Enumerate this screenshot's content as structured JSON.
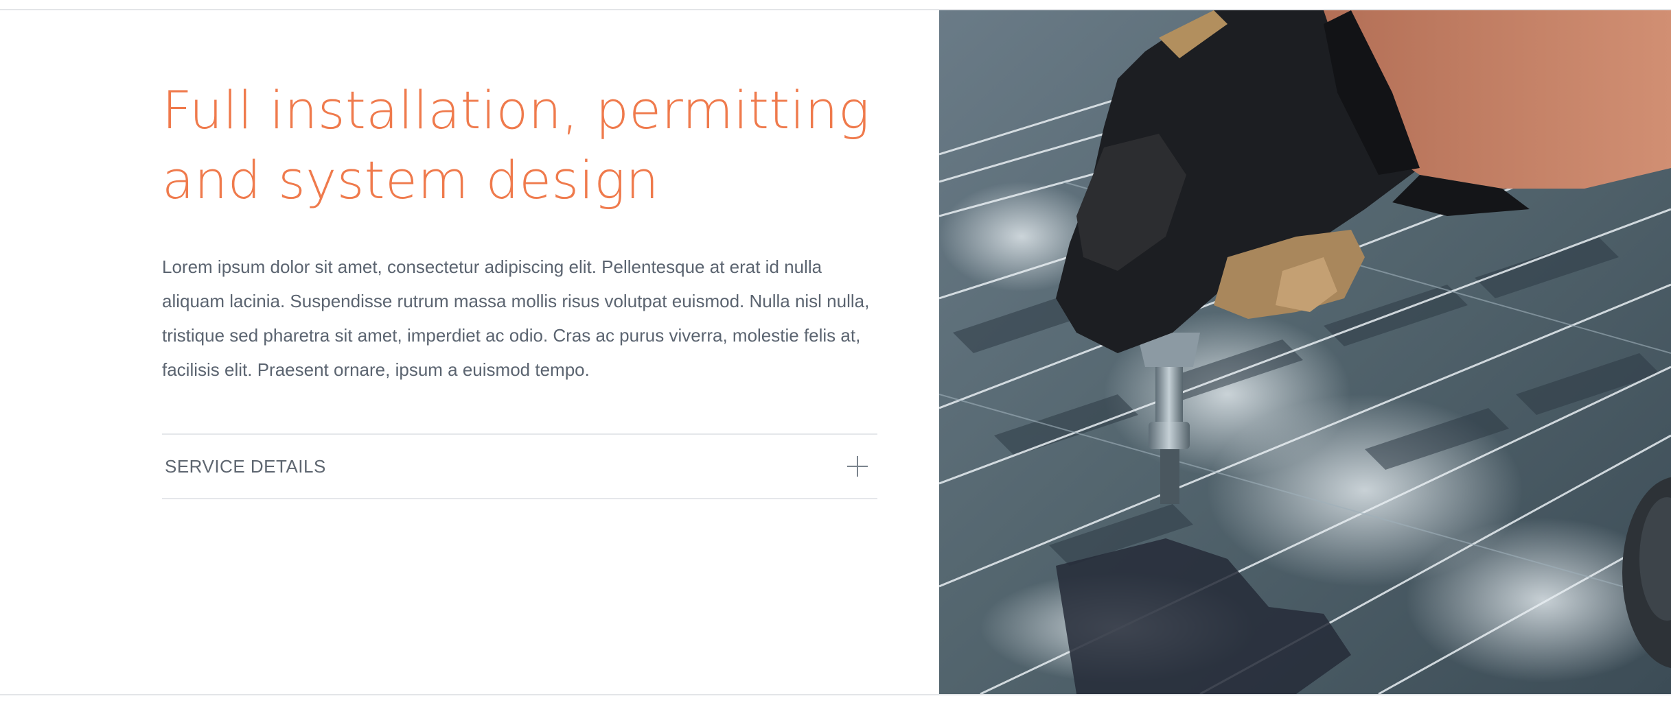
{
  "section": {
    "title_lines": [
      "Full installation, permitting",
      "and system design"
    ],
    "body": "Lorem ipsum dolor sit amet, consectetur adipiscing elit. Pellentesque at erat id nulla aliquam lacinia. Suspendisse rutrum massa mollis risus volutpat euismod. Nulla nisl nulla, tristique sed pharetra sit amet, imperdiet ac odio. Cras ac purus viverra, molestie felis at, facilisis elit. Praesent ornare, ipsum a euismod tempo.",
    "accordion": {
      "label": "SERVICE DETAILS",
      "icon": "plus-icon",
      "expanded": false
    }
  },
  "colors": {
    "accent": "#ef7a4c",
    "body_text": "#5b6470",
    "divider": "#e5e7ea"
  },
  "photo": {
    "subject": "gloved hand tightening a bolt on solar panels"
  }
}
